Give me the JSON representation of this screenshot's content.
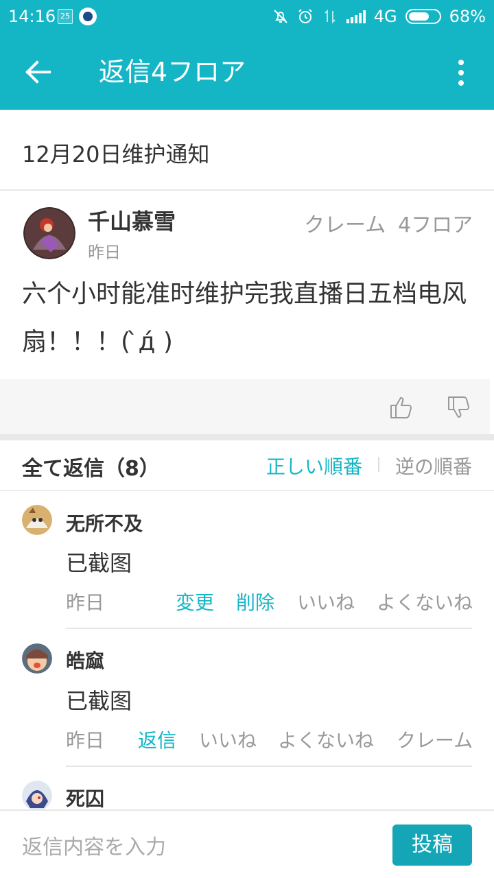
{
  "status_bar": {
    "time": "14:16",
    "notif_badge": "25",
    "network": "4G",
    "battery_percent": "68%",
    "battery_level": 0.68,
    "icons": [
      "mute-icon",
      "alarm-icon",
      "data-arrows-icon",
      "signal-icon",
      "battery-icon"
    ]
  },
  "app_bar": {
    "title": "返信4フロア",
    "icons": [
      "back-arrow-icon",
      "more-vert-icon"
    ]
  },
  "thread": {
    "title": "12月20日维护通知"
  },
  "post": {
    "author": "千山慕雪",
    "date": "昨日",
    "report_label": "クレーム",
    "floor_label": "4フロア",
    "content": "六个小时能准时维护完我直播日五档电风扇！！！( ̀д́ )"
  },
  "vote_bar": {
    "icons": [
      "thumbs-up-icon",
      "thumbs-down-icon"
    ]
  },
  "replies_header": {
    "all_label": "全て返信（8）",
    "sort_correct": "正しい順番",
    "sort_reverse": "逆の順番"
  },
  "replies": [
    {
      "name": "无所不及",
      "text": "已截图",
      "date": "昨日",
      "actions": [
        "変更",
        "削除",
        "いいね",
        "よくないね"
      ]
    },
    {
      "name": "皓窳",
      "text": "已截图",
      "date": "昨日",
      "actions": [
        "返信",
        "いいね",
        "よくないね",
        "クレーム"
      ]
    },
    {
      "name": "死囚"
    }
  ],
  "input_bar": {
    "placeholder": "返信内容を入力",
    "submit_label": "投稿"
  },
  "colors": {
    "accent": "#14b6c6",
    "button": "#14a6b6",
    "muted_text": "#999999"
  }
}
